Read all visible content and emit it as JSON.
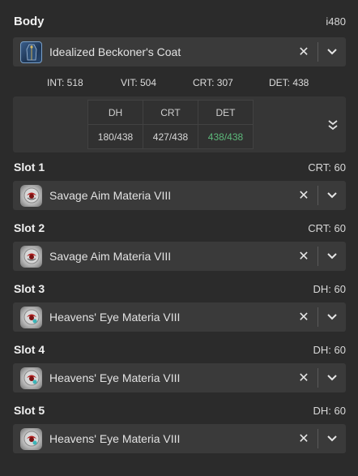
{
  "body": {
    "title": "Body",
    "item_level": "i480",
    "item_name": "Idealized Beckoner's Coat",
    "clear_symbol": "✕",
    "icon": "coat-icon"
  },
  "stats": {
    "int": "INT: 518",
    "vit": "VIT: 504",
    "crt": "CRT: 307",
    "det": "DET: 438"
  },
  "meld_table": {
    "headers": [
      "DH",
      "CRT",
      "DET"
    ],
    "values": [
      "180/438",
      "427/438",
      "438/438"
    ],
    "full_color": "#5cb87a"
  },
  "slots": [
    {
      "title": "Slot 1",
      "stat": "CRT: 60",
      "item_name": "Savage Aim Materia VIII",
      "clear_symbol": "✕"
    },
    {
      "title": "Slot 2",
      "stat": "CRT: 60",
      "item_name": "Savage Aim Materia VIII",
      "clear_symbol": "✕"
    },
    {
      "title": "Slot 3",
      "stat": "DH: 60",
      "item_name": "Heavens' Eye Materia VIII",
      "clear_symbol": "✕"
    },
    {
      "title": "Slot 4",
      "stat": "DH: 60",
      "item_name": "Heavens' Eye Materia VIII",
      "clear_symbol": "✕"
    },
    {
      "title": "Slot 5",
      "stat": "DH: 60",
      "item_name": "Heavens' Eye Materia VIII",
      "clear_symbol": "✕"
    }
  ]
}
